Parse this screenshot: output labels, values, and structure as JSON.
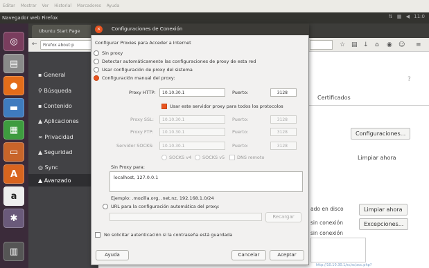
{
  "menubar": [
    "Editar",
    "Mostrar",
    "Ver",
    "Historial",
    "Marcadores",
    "Ayuda"
  ],
  "topbar": {
    "title": "Navegador web Firefox",
    "right": "11:0"
  },
  "tab": {
    "label": "Ubuntu Start Page"
  },
  "url": {
    "value": "Firefox  about:p"
  },
  "sidebar": {
    "items": [
      "General",
      "Búsqueda",
      "Contenido",
      "Aplicaciones",
      "Privacidad",
      "Seguridad",
      "Sync",
      "Avanzado"
    ]
  },
  "prefs": {
    "certificados": "Certificados",
    "configuraciones": "Configuraciones...",
    "limpiar_ahora": "Limpiar ahora",
    "limpiar_ahora2": "Limpiar ahora",
    "excepciones": "Excepciones...",
    "cache_disco": "ado en disco",
    "cache_conexion": "sin conexión",
    "un_conexion": "sin conexión"
  },
  "dialog": {
    "title": "Configuraciones de Conexión",
    "heading": "Configurar Proxies para Acceder a Internet",
    "opt_none": "Sin proxy",
    "opt_auto": "Detectar automáticamente las configuraciones de proxy de esta red",
    "opt_system": "Usar configuración de proxy del sistema",
    "opt_manual": "Configuración manual del proxy:",
    "http_label": "Proxy HTTP:",
    "http_value": "10.10.30.1",
    "port_label": "Puerto:",
    "http_port": "3128",
    "same_proxy": "Usar este servidor proxy para todos los protocolos",
    "ssl_label": "Proxy SSL:",
    "ssl_value": "10.10.30.1",
    "ssl_port": "3128",
    "ftp_label": "Proxy FTP:",
    "ftp_value": "10.10.30.1",
    "ftp_port": "3128",
    "socks_label": "Servidor SOCKS:",
    "socks_value": "10.10.30.1",
    "socks_port": "3128",
    "socks4": "SOCKS v4",
    "socks5": "SOCKS v5",
    "remote_dns": "DNS remoto",
    "noproxy_label": "Sin Proxy para:",
    "noproxy_value": "localhost, 127.0.0.1",
    "example": "Ejemplo: .mozilla.org, .net.nz, 192.168.1.0/24",
    "pac": "URL para la configuración automática del proxy:",
    "reload": "Recargar",
    "no_auth": "No solicitar autenticación si la contraseña está guardada",
    "help": "Ayuda",
    "cancel": "Cancelar",
    "accept": "Aceptar"
  },
  "bottom": {
    "link": "http://10.10.30.1/sc/sc/acc.php?"
  }
}
